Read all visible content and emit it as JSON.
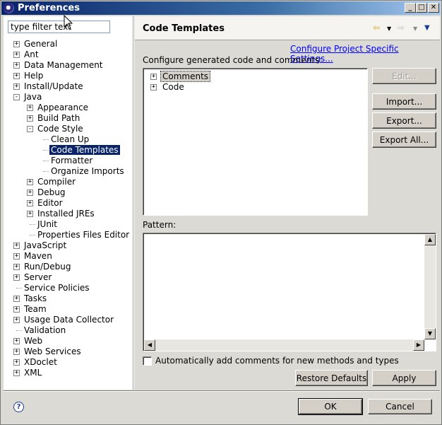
{
  "window": {
    "title": "Preferences"
  },
  "filter": {
    "value": "type filter text"
  },
  "tree": [
    {
      "label": "General",
      "toggle": "+",
      "depth": 0
    },
    {
      "label": "Ant",
      "toggle": "+",
      "depth": 0
    },
    {
      "label": "Data Management",
      "toggle": "+",
      "depth": 0
    },
    {
      "label": "Help",
      "toggle": "+",
      "depth": 0
    },
    {
      "label": "Install/Update",
      "toggle": "+",
      "depth": 0
    },
    {
      "label": "Java",
      "toggle": "-",
      "depth": 0
    },
    {
      "label": "Appearance",
      "toggle": "+",
      "depth": 1
    },
    {
      "label": "Build Path",
      "toggle": "+",
      "depth": 1
    },
    {
      "label": "Code Style",
      "toggle": "-",
      "depth": 1
    },
    {
      "label": "Clean Up",
      "toggle": "",
      "depth": 2
    },
    {
      "label": "Code Templates",
      "toggle": "",
      "depth": 2,
      "selected": true
    },
    {
      "label": "Formatter",
      "toggle": "",
      "depth": 2
    },
    {
      "label": "Organize Imports",
      "toggle": "",
      "depth": 2
    },
    {
      "label": "Compiler",
      "toggle": "+",
      "depth": 1
    },
    {
      "label": "Debug",
      "toggle": "+",
      "depth": 1
    },
    {
      "label": "Editor",
      "toggle": "+",
      "depth": 1
    },
    {
      "label": "Installed JREs",
      "toggle": "+",
      "depth": 1
    },
    {
      "label": "JUnit",
      "toggle": "",
      "depth": 1
    },
    {
      "label": "Properties Files Editor",
      "toggle": "",
      "depth": 1
    },
    {
      "label": "JavaScript",
      "toggle": "+",
      "depth": 0
    },
    {
      "label": "Maven",
      "toggle": "+",
      "depth": 0
    },
    {
      "label": "Run/Debug",
      "toggle": "+",
      "depth": 0
    },
    {
      "label": "Server",
      "toggle": "+",
      "depth": 0
    },
    {
      "label": "Service Policies",
      "toggle": "",
      "depth": 0
    },
    {
      "label": "Tasks",
      "toggle": "+",
      "depth": 0
    },
    {
      "label": "Team",
      "toggle": "+",
      "depth": 0
    },
    {
      "label": "Usage Data Collector",
      "toggle": "+",
      "depth": 0
    },
    {
      "label": "Validation",
      "toggle": "",
      "depth": 0
    },
    {
      "label": "Web",
      "toggle": "+",
      "depth": 0
    },
    {
      "label": "Web Services",
      "toggle": "+",
      "depth": 0
    },
    {
      "label": "XDoclet",
      "toggle": "+",
      "depth": 0
    },
    {
      "label": "XML",
      "toggle": "+",
      "depth": 0
    }
  ],
  "page": {
    "title": "Code Templates",
    "project_link": "Configure Project Specific Settings...",
    "configure_label": "Configure generated code and comments:",
    "templates": [
      {
        "label": "Comments",
        "toggle": "+"
      },
      {
        "label": "Code",
        "toggle": "+"
      }
    ],
    "buttons": {
      "edit": "Edit...",
      "import": "Import...",
      "export": "Export...",
      "export_all": "Export All..."
    },
    "pattern_label": "Pattern:",
    "auto_comments_label": "Automatically add comments for new methods and types",
    "auto_comments_checked": false,
    "restore_defaults": "Restore Defaults",
    "apply": "Apply"
  },
  "dialog": {
    "ok": "OK",
    "cancel": "Cancel"
  }
}
